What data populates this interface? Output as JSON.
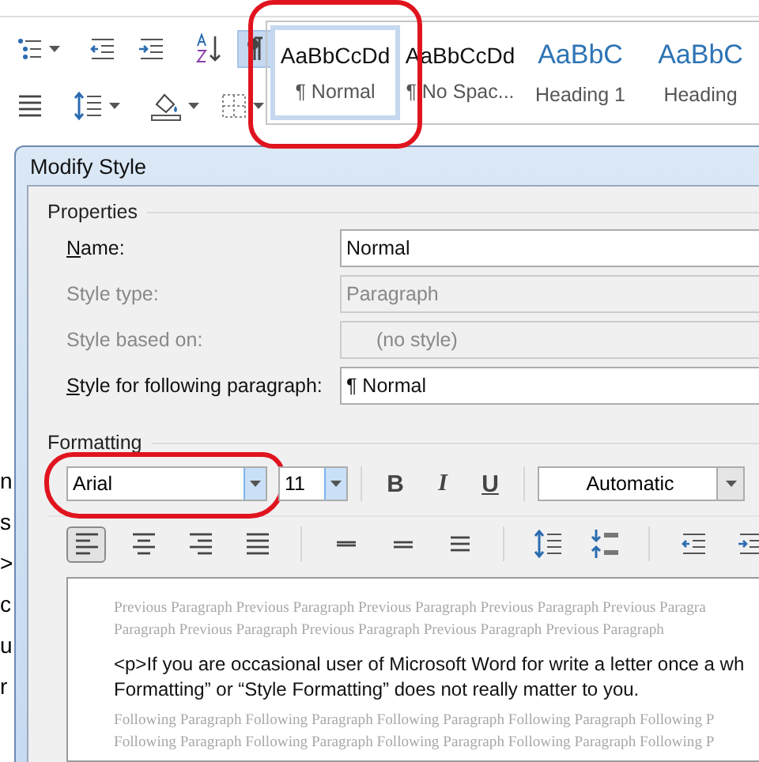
{
  "ribbon": {
    "row1": [
      {
        "kind": "multilevel-list",
        "dropdown": true,
        "selected": false
      },
      {
        "kind": "decrease-indent",
        "dropdown": false,
        "selected": false
      },
      {
        "kind": "increase-indent",
        "dropdown": false,
        "selected": false
      },
      {
        "kind": "sort",
        "dropdown": false,
        "selected": false
      },
      {
        "kind": "pilcrow",
        "dropdown": false,
        "selected": true
      }
    ],
    "row2": [
      {
        "kind": "justify",
        "dropdown": false,
        "selected": false
      },
      {
        "kind": "line-spacing",
        "dropdown": true,
        "selected": false
      },
      {
        "kind": "shading",
        "dropdown": true,
        "selected": false
      },
      {
        "kind": "borders",
        "dropdown": true,
        "selected": false
      }
    ],
    "styles": [
      {
        "sample": "AaBbCcDd",
        "label": "¶ Normal",
        "kind": "body",
        "selected": true,
        "circled": true
      },
      {
        "sample": "AaBbCcDd",
        "label": "¶ No Spac...",
        "kind": "body",
        "selected": false,
        "circled": false
      },
      {
        "sample": "AaBbC",
        "label": "Heading 1",
        "kind": "heading",
        "selected": false,
        "circled": false
      },
      {
        "sample": "AaBbC",
        "label": "Heading",
        "kind": "heading",
        "selected": false,
        "circled": false
      }
    ]
  },
  "document_fragments": [
    "n",
    "s",
    ">",
    "c",
    "u",
    "r"
  ],
  "dialog": {
    "title": "Modify Style",
    "properties": {
      "title": "Properties",
      "rows": [
        {
          "access_key": "N",
          "label": "ame:",
          "value": "Normal",
          "disabled": false
        },
        {
          "label": "Style type:",
          "value": "Paragraph",
          "disabled": true
        },
        {
          "label": "Style based on:",
          "value": "(no style)",
          "disabled": true
        },
        {
          "access_key": "S",
          "label": "tyle for following paragraph:",
          "value": "¶ Normal",
          "disabled": false
        }
      ]
    },
    "formatting": {
      "title": "Formatting",
      "font": {
        "value": "Arial",
        "circled": true
      },
      "size": "11",
      "bold": "B",
      "italic": "I",
      "underline": "U",
      "font_color": "Automatic",
      "tools": [
        {
          "kind": "align-left",
          "selected": true
        },
        {
          "kind": "align-center",
          "selected": false
        },
        {
          "kind": "align-right",
          "selected": false
        },
        {
          "kind": "justify",
          "selected": false
        },
        {
          "kind": "single-spacing",
          "selected": false
        },
        {
          "kind": "one-half-spacing",
          "selected": false
        },
        {
          "kind": "double-spacing",
          "selected": false
        },
        {
          "kind": "increase-spacing",
          "selected": false
        },
        {
          "kind": "decrease-spacing",
          "selected": false
        },
        {
          "kind": "decrease-indent",
          "selected": false
        },
        {
          "kind": "increase-indent",
          "selected": false
        }
      ]
    },
    "preview": {
      "previous": [
        "Previous Paragraph Previous Paragraph Previous Paragraph Previous Paragraph Previous Paragra",
        "Paragraph Previous Paragraph Previous Paragraph Previous Paragraph Previous Paragraph"
      ],
      "current": [
        "<p>If you are occasional user of Microsoft Word for write a letter once a wh",
        "Formatting” or “Style Formatting” does not really matter to you."
      ],
      "following": [
        "Following Paragraph Following Paragraph Following Paragraph Following Paragraph Following P",
        "Following Paragraph Following Paragraph Following Paragraph Following Paragraph Following P"
      ]
    }
  }
}
